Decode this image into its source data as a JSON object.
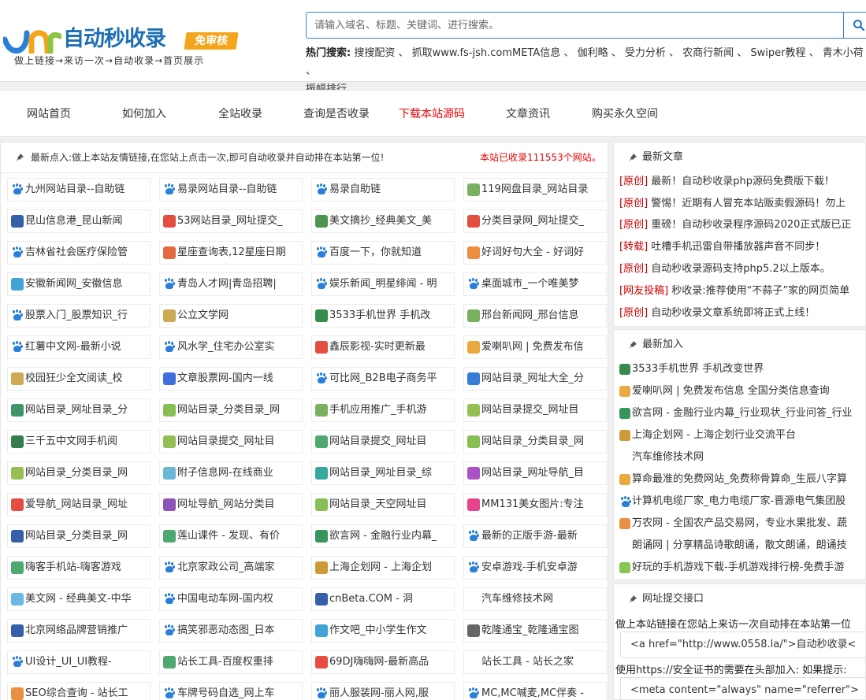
{
  "header": {
    "logo_text": "自动秒收录",
    "logo_badge": "免审核",
    "slogan": "做上链接→来访一次→自动收录→首页展示",
    "search_placeholder": "请输入域名、标题、关键词、进行搜索。",
    "hot_label": "热门搜索:",
    "hot_items": [
      "搜搜配资 、",
      "抓取www.fs-jsh.comMETA信息 、",
      "伽利略 、",
      "受力分析 、",
      "农商行新闻 、",
      "Swiper教程 、",
      "青木小荷 、",
      "振幅排行 、"
    ]
  },
  "nav": {
    "items": [
      {
        "label": "网站首页",
        "color": "#333333"
      },
      {
        "label": "如何加入",
        "color": "#333333"
      },
      {
        "label": "全站收录",
        "color": "#333333"
      },
      {
        "label": "查询是否收录",
        "color": "#333333"
      },
      {
        "label": "下载本站源码",
        "color": "#ee0000"
      },
      {
        "label": "文章资讯",
        "color": "#333333"
      },
      {
        "label": "购买永久空间",
        "color": "#333333"
      }
    ]
  },
  "notice": {
    "text": "最新点入:做上本站友情链接,在您站上点击一次,即可自动收录并自动排在本站第一位!",
    "count": "本站已收录111553个网站。"
  },
  "sites": [
    {
      "label": "九州网站目录--自助链",
      "icon": "paw-icon",
      "color": "#2a7fd8"
    },
    {
      "label": "易录网站目录--自助链",
      "icon": "paw-icon",
      "color": "#2a7fd8"
    },
    {
      "label": "易录自助链",
      "icon": "paw-icon",
      "color": "#2a7fd8"
    },
    {
      "label": "119网盘目录_网站目录",
      "icon": "leaf-icon",
      "color": "#6aa84f"
    },
    {
      "label": "昆山信息港_昆山新闻",
      "icon": "w-icon",
      "color": "#1f4fa0"
    },
    {
      "label": "53网站目录_网址提交_",
      "icon": "53-icon",
      "color": "#e03b2c"
    },
    {
      "label": "美文摘抄_经典美文_美",
      "icon": "tree-icon",
      "color": "#3a8a3a"
    },
    {
      "label": "分类目录网_网址提交_",
      "icon": "53-icon",
      "color": "#e03b2c"
    },
    {
      "label": "吉林省社会医疗保险管",
      "icon": "paw-icon",
      "color": "#2a7fd8"
    },
    {
      "label": "星座查询表,12星座日期",
      "icon": "star-icon",
      "color": "#e25a2c"
    },
    {
      "label": "百度一下，你就知道",
      "icon": "paw-icon",
      "color": "#2a7fd8"
    },
    {
      "label": "好词好句大全 - 好词好",
      "icon": "quote-icon",
      "color": "#e8822a"
    },
    {
      "label": "安徽新闻网_安徽信息",
      "icon": "swirl-icon",
      "color": "#2e9ad0"
    },
    {
      "label": "青岛人才网|青岛招聘|",
      "icon": "paw-icon",
      "color": "#2a7fd8"
    },
    {
      "label": "娱乐新闻_明星绯闻 - 明",
      "icon": "paw-icon",
      "color": "#2a7fd8"
    },
    {
      "label": "桌面城市_一个唯美梦",
      "icon": "paw-icon",
      "color": "#2a7fd8"
    },
    {
      "label": "股票入门_股票知识_行",
      "icon": "paw-icon",
      "color": "#2a7fd8"
    },
    {
      "label": "公立文学网",
      "icon": "cube-icon",
      "color": "#c8a040"
    },
    {
      "label": "3533手机世界 手机改",
      "icon": "s-icon",
      "color": "#1f7f3a"
    },
    {
      "label": "邢台新闻网_邢台信息",
      "icon": "leaf-icon",
      "color": "#6aa84f"
    },
    {
      "label": "红薯中文网-最新小说",
      "icon": "paw-icon",
      "color": "#2a7fd8"
    },
    {
      "label": "风水学_住宅办公室实",
      "icon": "paw-icon",
      "color": "#2a7fd8"
    },
    {
      "label": "鑫辰影视-实时更新最",
      "icon": "play-icon",
      "color": "#e03b2c"
    },
    {
      "label": "爱喇叭网 | 免费发布信",
      "icon": "speaker-icon",
      "color": "#e8a02a"
    },
    {
      "label": "校园狂少全文阅读_校",
      "icon": "cube-icon",
      "color": "#c8a040"
    },
    {
      "label": "文章股票网-国内一线",
      "icon": "chart-icon",
      "color": "#2a5fd8"
    },
    {
      "label": "可比网_B2B电子商务平",
      "icon": "paw-icon",
      "color": "#2a7fd8"
    },
    {
      "label": "网站目录_网址大全_分",
      "icon": "a-icon",
      "color": "#1f6fd0"
    },
    {
      "label": "网站目录_网址目录_分",
      "icon": "leaf-icon",
      "color": "#2a8a5a"
    },
    {
      "label": "网站目录_分类目录_网",
      "icon": "leaf-icon",
      "color": "#7ab840"
    },
    {
      "label": "手机应用推广_手机游",
      "icon": "ring-icon",
      "color": "#6aa84f"
    },
    {
      "label": "网站目录提交_网址目",
      "icon": "moon-icon",
      "color": "#8ab840"
    },
    {
      "label": "三千五中文网手机阅",
      "icon": "five-icon",
      "color": "#1f6f3a"
    },
    {
      "label": "网站目录提交_网址目",
      "icon": "moon-icon",
      "color": "#8ab840"
    },
    {
      "label": "网站目录提交_网址目",
      "icon": "drop-icon",
      "color": "#3aa060"
    },
    {
      "label": "网站目录_分类目录_网",
      "icon": "pin-icon",
      "color": "#7ab840"
    },
    {
      "label": "网站目录_分类目录_网",
      "icon": "ring-icon",
      "color": "#8ab840"
    },
    {
      "label": "附子信息网-在线商业",
      "icon": "grid-icon",
      "color": "#5ab0d0"
    },
    {
      "label": "网站目录_网址目录_综",
      "icon": "p-icon",
      "color": "#1fa090"
    },
    {
      "label": "网站目录_网址导航_目",
      "icon": "flower-icon",
      "color": "#a040c0"
    },
    {
      "label": "爱导航_网站目录_网址",
      "icon": "heart-icon",
      "color": "#e03b2c"
    },
    {
      "label": "网址导航_网站分类目",
      "icon": "flower-icon",
      "color": "#8040b0"
    },
    {
      "label": "网站目录_天空网址目",
      "icon": "leaf-icon",
      "color": "#7ab840"
    },
    {
      "label": "MM131美女图片:专注",
      "icon": "m-icon",
      "color": "#e03080"
    },
    {
      "label": "网站目录_分类目录_网",
      "icon": "f-icon",
      "color": "#1f4fa0"
    },
    {
      "label": "莲山课件 - 发现、有价",
      "icon": "tree-icon",
      "color": "#3aa060"
    },
    {
      "label": "欲言网 - 金融行业内幕_",
      "icon": "yan-icon",
      "color": "#1f8a4a"
    },
    {
      "label": "最新的正版手游-最新",
      "icon": "paw-icon",
      "color": "#2a7fd8"
    },
    {
      "label": "嗨客手机站-嗨客游戏",
      "icon": "c-icon",
      "color": "#3aa060"
    },
    {
      "label": "北京家政公司_高端家",
      "icon": "paw-icon",
      "color": "#2a7fd8"
    },
    {
      "label": "上海企划网 - 上海企划",
      "icon": "gold-icon",
      "color": "#c89020"
    },
    {
      "label": "安卓游戏-手机安卓游",
      "icon": "paw-icon",
      "color": "#2a7fd8"
    },
    {
      "label": "美文网 - 经典美文-中华",
      "icon": "swirl-icon",
      "color": "#5ab0e0"
    },
    {
      "label": "中国电动车网-国内权",
      "icon": "paw-icon",
      "color": "#2a7fd8"
    },
    {
      "label": "cnBeta.COM - 洞",
      "icon": "dots-icon",
      "color": "#1f4fa0"
    },
    {
      "label": "汽车维修技术网",
      "icon": "",
      "color": ""
    },
    {
      "label": "北京网络品牌营销推广",
      "icon": "dash-icon",
      "color": "#1f4fa0"
    },
    {
      "label": "搞笑邪恶动态图_日本",
      "icon": "paw-icon",
      "color": "#2a7fd8"
    },
    {
      "label": "作文吧_中小学生作文",
      "icon": "book-icon",
      "color": "#2a9ad0"
    },
    {
      "label": "乾隆通宝_乾隆通宝图",
      "icon": "coin-icon",
      "color": "#555555"
    },
    {
      "label": "UI设计_UI_UI教程-",
      "icon": "paw-icon",
      "color": "#2a7fd8"
    },
    {
      "label": "站长工具-百度权重排",
      "icon": "tool-icon",
      "color": "#3aa060"
    },
    {
      "label": "69DJ嗨嗨网-最新高品",
      "icon": "disc-icon",
      "color": "#e03b2c"
    },
    {
      "label": "站长工具 - 站长之家",
      "icon": "",
      "color": ""
    },
    {
      "label": "SEO综合查询 - 站长工",
      "icon": "seo-icon",
      "color": "#e8822a"
    },
    {
      "label": "车牌号码自选_网上车",
      "icon": "paw-icon",
      "color": "#2a7fd8"
    },
    {
      "label": "丽人服装网-丽人网,服",
      "icon": "paw-icon",
      "color": "#2a7fd8"
    },
    {
      "label": "MC,MC喊麦,MC伴奏 -",
      "icon": "paw-icon",
      "color": "#2a7fd8"
    }
  ],
  "articles": {
    "title": "最新文章",
    "items": [
      {
        "tag": "[原创]",
        "text": "最新！自动秒收录php源码免费版下载！"
      },
      {
        "tag": "[原创]",
        "text": "警惕！近期有人冒充本站贩卖假源码！勿上"
      },
      {
        "tag": "[原创]",
        "text": "重磅！自动秒收录程序源码2020正式版已正"
      },
      {
        "tag": "[转载]",
        "text": "吐槽手机迅雷自带播放器声音不同步！"
      },
      {
        "tag": "[原创]",
        "text": "自动秒收录源码支持php5.2以上版本。"
      },
      {
        "tag": "[网友投稿]",
        "text": "秒收录:推荐使用“不蒜子”家的网页简单"
      },
      {
        "tag": "[原创]",
        "text": "自动秒收录文章系统即将正式上线！"
      }
    ]
  },
  "newest": {
    "title": "最新加入",
    "items": [
      {
        "text": "3533手机世界 手机改变世界",
        "icon": "s-icon",
        "color": "#1f7f3a"
      },
      {
        "text": "爱喇叭网 | 免费发布信息 全国分类信息查询",
        "icon": "speaker-icon",
        "color": "#e8a02a"
      },
      {
        "text": "欲言网 - 金融行业内幕_行业现状_行业问答_行业",
        "icon": "yan-icon",
        "color": "#1f8a4a"
      },
      {
        "text": "上海企划网 - 上海企划行业交流平台",
        "icon": "gold-icon",
        "color": "#c89020"
      },
      {
        "text": "汽车维修技术网",
        "icon": "",
        "color": ""
      },
      {
        "text": "算命最准的免费网站_免费称骨算命_生辰八字算",
        "icon": "jing-icon",
        "color": "#e8a02a"
      },
      {
        "text": "计算机电缆厂家_电力电缆厂家-晋源电气集团股",
        "icon": "paw-icon",
        "color": "#2a7fd8"
      },
      {
        "text": "万农网 - 全国农产品交易网，专业水果批发、蔬",
        "icon": "wan-icon",
        "color": "#e8822a"
      },
      {
        "text": "朗诵网 | 分享精品诗歌朗诵，散文朗诵，朗诵技",
        "icon": "",
        "color": ""
      },
      {
        "text": "好玩的手机游戏下载-手机游戏排行榜-免费手游",
        "icon": "game-icon",
        "color": "#7ac040"
      }
    ]
  },
  "submit": {
    "title": "网址提交接口",
    "line1": "做上本站链接在您站上来访一次自动排在本站第一位",
    "code1": "<a href=\"http://www.0558.la/\">自动秒收录<",
    "line2": "使用https://安全证书的需要在头部加入: 如果提示:",
    "code2": "<meta content=\"always\" name=\"referrer\">"
  }
}
